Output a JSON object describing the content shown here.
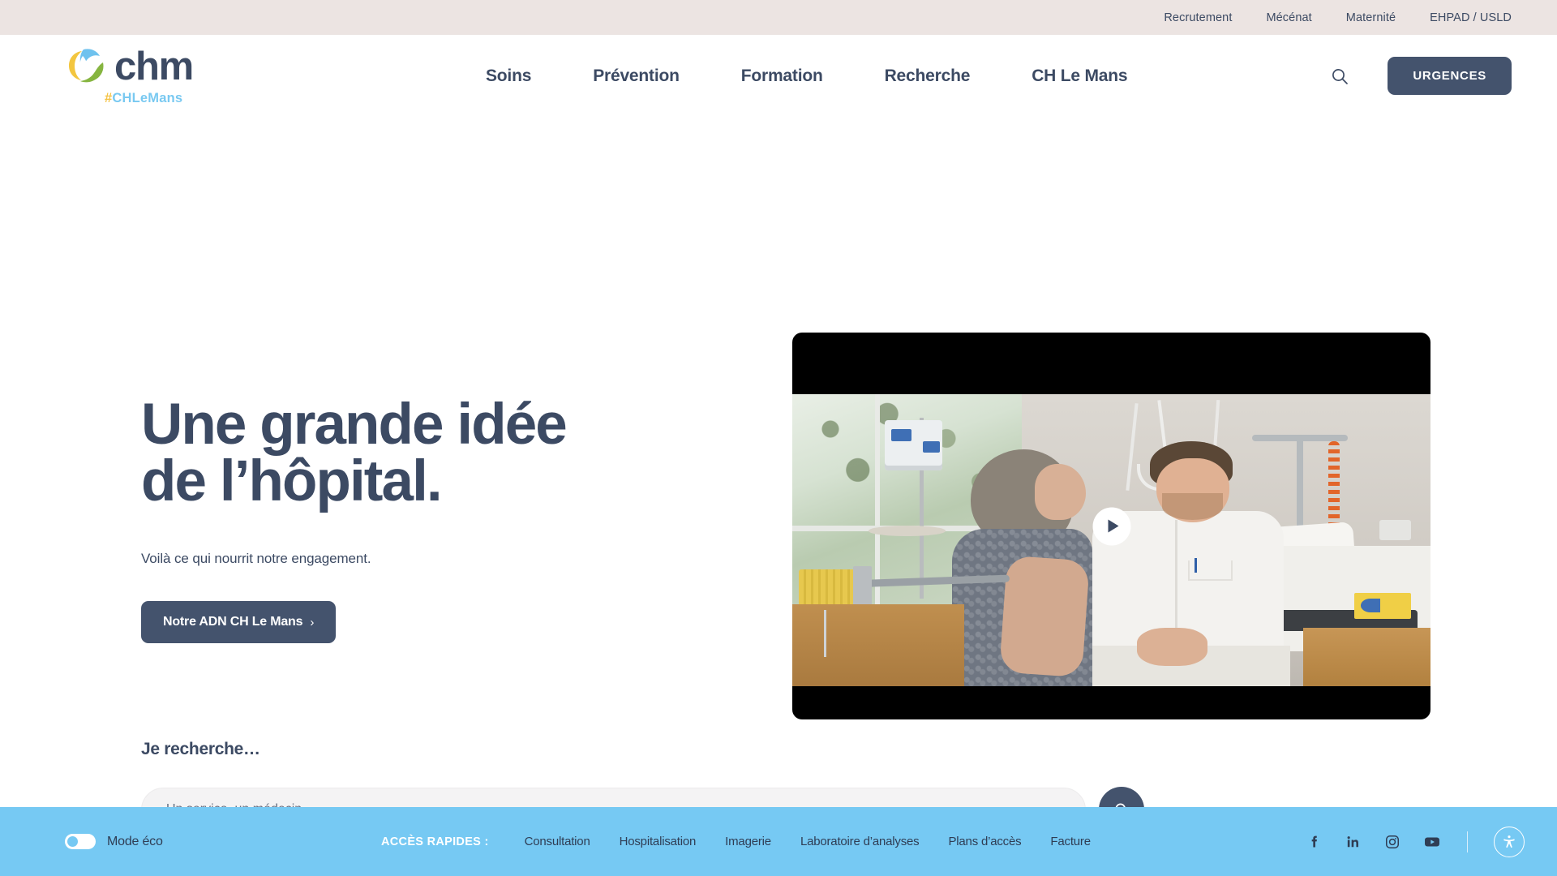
{
  "topbar": {
    "links": [
      {
        "label": "Recrutement"
      },
      {
        "label": "Mécénat"
      },
      {
        "label": "Maternité"
      },
      {
        "label": "EHPAD / USLD"
      }
    ]
  },
  "header": {
    "logo": {
      "wordmark": "chm",
      "hash": "#",
      "tagline": "CHLeMans",
      "colors": {
        "yellow": "#F3C63F",
        "blue": "#6FC2EE",
        "green": "#86B540",
        "navy": "#3C4A63"
      }
    },
    "nav": [
      {
        "label": "Soins"
      },
      {
        "label": "Prévention"
      },
      {
        "label": "Formation"
      },
      {
        "label": "Recherche"
      },
      {
        "label": "CH Le Mans"
      }
    ],
    "search_icon": "search-icon",
    "emergency_button": "URGENCES"
  },
  "hero": {
    "title_line1": "Une grande idée",
    "title_line2": "de l’hôpital.",
    "subtitle": "Voilà ce qui nourrit notre engagement.",
    "cta_label": "Notre ADN CH Le Mans",
    "cta_chevron": "›"
  },
  "video": {
    "play_icon": "play-icon",
    "caption": ""
  },
  "search": {
    "heading": "Je recherche…",
    "placeholder": "Un service, un médecin…",
    "value": "",
    "submit_icon": "search-icon"
  },
  "footer": {
    "eco_label": "Mode éco",
    "eco_state": "off",
    "quick_title": "ACCÈS RAPIDES :",
    "quick_links": [
      {
        "label": "Consultation"
      },
      {
        "label": "Hospitalisation"
      },
      {
        "label": "Imagerie"
      },
      {
        "label": "Laboratoire d’analyses"
      },
      {
        "label": "Plans d’accès"
      },
      {
        "label": "Facture"
      }
    ],
    "socials": [
      {
        "name": "facebook-icon"
      },
      {
        "name": "linkedin-icon"
      },
      {
        "name": "instagram-icon"
      },
      {
        "name": "youtube-icon"
      }
    ],
    "accessibility_icon": "accessibility-icon"
  },
  "colors": {
    "topbar_bg": "#ECE4E2",
    "navy": "#3C4A63",
    "button_navy": "#44536D",
    "footer_blue": "#76C9F3",
    "field_bg": "#F4F3F4"
  }
}
